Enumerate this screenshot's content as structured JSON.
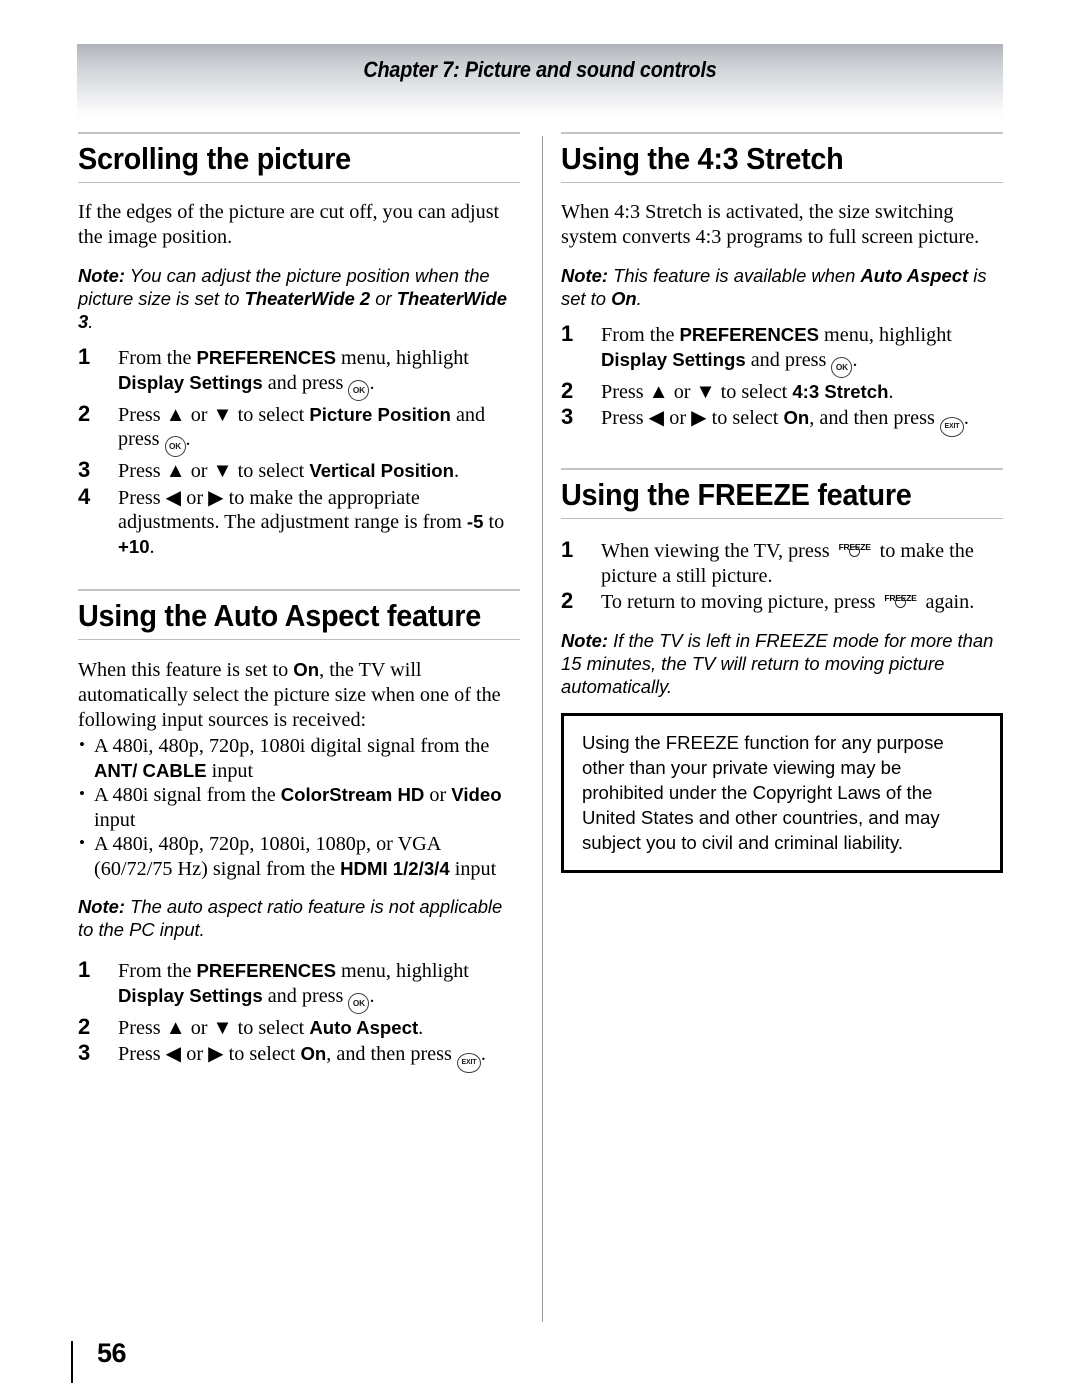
{
  "header": {
    "chapter_title": "Chapter 7: Picture and sound controls"
  },
  "footer": {
    "page_number": "56"
  },
  "icons": {
    "ok_label": "OK",
    "exit_label": "EXIT",
    "freeze_label": "FREEZE",
    "up_arrow": "▲",
    "down_arrow": "▼",
    "left_arrow": "◀",
    "right_arrow": "▶",
    "bullet": "•"
  },
  "colors": {
    "header_gradient_top": "#b0b4ba",
    "header_gradient_bottom": "#ffffff",
    "rule_gray": "#c3c3c3",
    "divider_gray": "#9a9a9a",
    "warning_border": "#000000",
    "text": "#000000"
  },
  "left_column": {
    "sections": [
      {
        "heading": "Scrolling the picture",
        "paragraphs": [
          "If the edges of the picture are cut off, you can adjust the image position."
        ],
        "note": {
          "label": "Note:",
          "text_1": " You can adjust the picture position when the picture size is set to ",
          "bold_1": "TheaterWide 2",
          "text_2": " or ",
          "bold_2": "TheaterWide 3",
          "text_3": "."
        },
        "steps": [
          {
            "num": "1",
            "t1": "From the ",
            "b1": "PREFERENCES",
            "t2": " menu, highlight ",
            "b2": "Display Settings",
            "t3": " and press ",
            "key": "ok",
            "t4": "."
          },
          {
            "num": "2",
            "t1": "Press ▲ or ▼ to select ",
            "b1": "Picture Position",
            "t2": " and press ",
            "key": "ok",
            "t3": "."
          },
          {
            "num": "3",
            "t1": "Press ▲ or ▼ to select ",
            "b1": "Vertical Position",
            "t2": "."
          },
          {
            "num": "4",
            "t1": "Press ◀ or ▶ to make the appropriate adjustments. The adjustment range is from ",
            "b1": "-5",
            "t2": " to ",
            "b2": "+10",
            "t3": "."
          }
        ]
      },
      {
        "heading": "Using the Auto Aspect feature",
        "paragraph_1_a": "When this feature is set to ",
        "paragraph_1_bold": "On",
        "paragraph_1_b": ", the TV will automatically select the picture size when one of the following input sources is received:",
        "bullets": [
          {
            "t1": "A 480i, 480p, 720p, 1080i digital signal from the ",
            "b1": "ANT/ CABLE",
            "t2": " input"
          },
          {
            "t1": "A 480i signal from the ",
            "b1": "ColorStream HD",
            "t2": " or ",
            "b2": "Video",
            "t3": " input"
          },
          {
            "t1": "A 480i, 480p, 720p, 1080i, 1080p, or VGA (60/72/75 Hz) signal from the ",
            "b1": "HDMI 1/2/3/4",
            "t2": " input"
          }
        ],
        "note": {
          "label": "Note:",
          "text_1": " The auto aspect ratio feature is not applicable to the PC input."
        },
        "steps": [
          {
            "num": "1",
            "t1": "From the ",
            "b1": "PREFERENCES",
            "t2": " menu, highlight ",
            "b2": "Display Settings",
            "t3": " and press ",
            "key": "ok",
            "t4": "."
          },
          {
            "num": "2",
            "t1": "Press ▲ or ▼ to select ",
            "b1": "Auto Aspect",
            "t2": "."
          },
          {
            "num": "3",
            "t1": "Press ◀ or ▶ to select ",
            "b1": "On",
            "t2": ", and then press ",
            "key": "exit",
            "t3": "."
          }
        ]
      }
    ]
  },
  "right_column": {
    "sections": [
      {
        "heading": "Using the 4:3 Stretch",
        "paragraphs": [
          "When 4:3 Stretch is activated, the size switching system converts 4:3 programs to full screen picture."
        ],
        "note": {
          "label": "Note:",
          "text_1": " This feature is available when ",
          "bold_1": "Auto Aspect",
          "text_2": " is set to ",
          "bold_2": "On",
          "text_3": "."
        },
        "steps": [
          {
            "num": "1",
            "t1": "From the ",
            "b1": "PREFERENCES",
            "t2": " menu, highlight ",
            "b2": "Display Settings",
            "t3": " and press ",
            "key": "ok",
            "t4": "."
          },
          {
            "num": "2",
            "t1": "Press ▲ or ▼ to select ",
            "b1": "4:3 Stretch",
            "t2": "."
          },
          {
            "num": "3",
            "t1": "Press ◀ or ▶ to select ",
            "b1": "On",
            "t2": ", and then press ",
            "key": "exit",
            "t3": "."
          }
        ]
      },
      {
        "heading": "Using the FREEZE feature",
        "steps": [
          {
            "num": "1",
            "t1": "When viewing the TV, press ",
            "key": "freeze",
            "t2": " to make the picture a still picture."
          },
          {
            "num": "2",
            "t1": "To return to moving picture, press ",
            "key": "freeze",
            "t2": " again."
          }
        ],
        "note": {
          "label": "Note:",
          "text_1": " If the TV is left in FREEZE mode for more than 15 minutes, the TV will return to moving picture automatically."
        },
        "warning": "Using the FREEZE function for any purpose other than your private viewing may be prohibited under the Copyright Laws of the United States and other countries, and may subject you to civil and criminal liability."
      }
    ]
  }
}
